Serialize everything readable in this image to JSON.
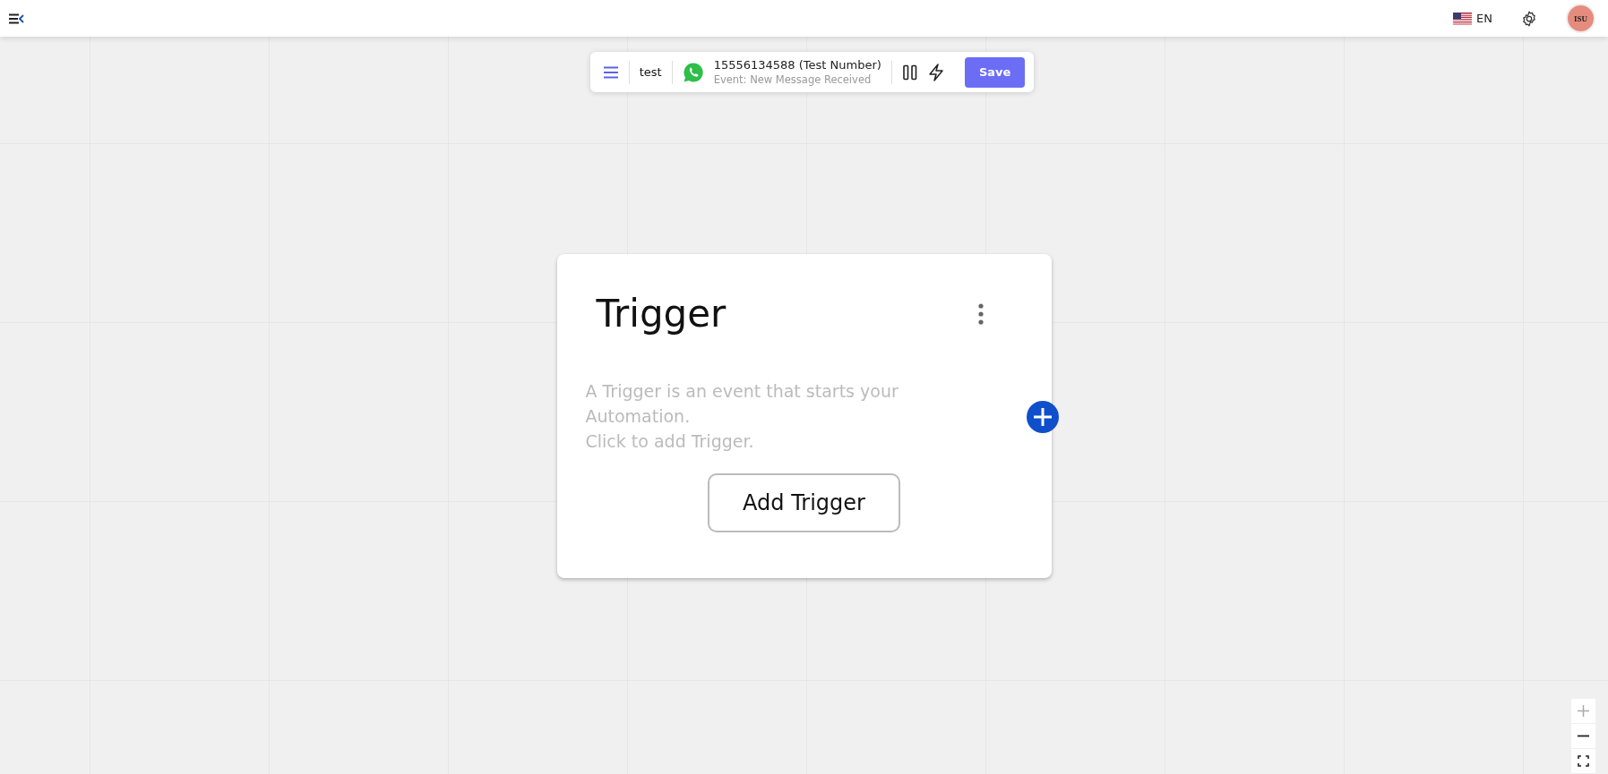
{
  "top_bar": {
    "language": "EN",
    "avatar_initials": "ISU"
  },
  "toolbar": {
    "name": "test",
    "number": "15556134588 (Test Number)",
    "event": "Event: New Message Received",
    "save": "Save"
  },
  "trigger_card": {
    "title": "Trigger",
    "description": [
      "A Trigger is an event that starts your Automation.",
      "Click to add Trigger."
    ],
    "button": "Add Trigger"
  }
}
